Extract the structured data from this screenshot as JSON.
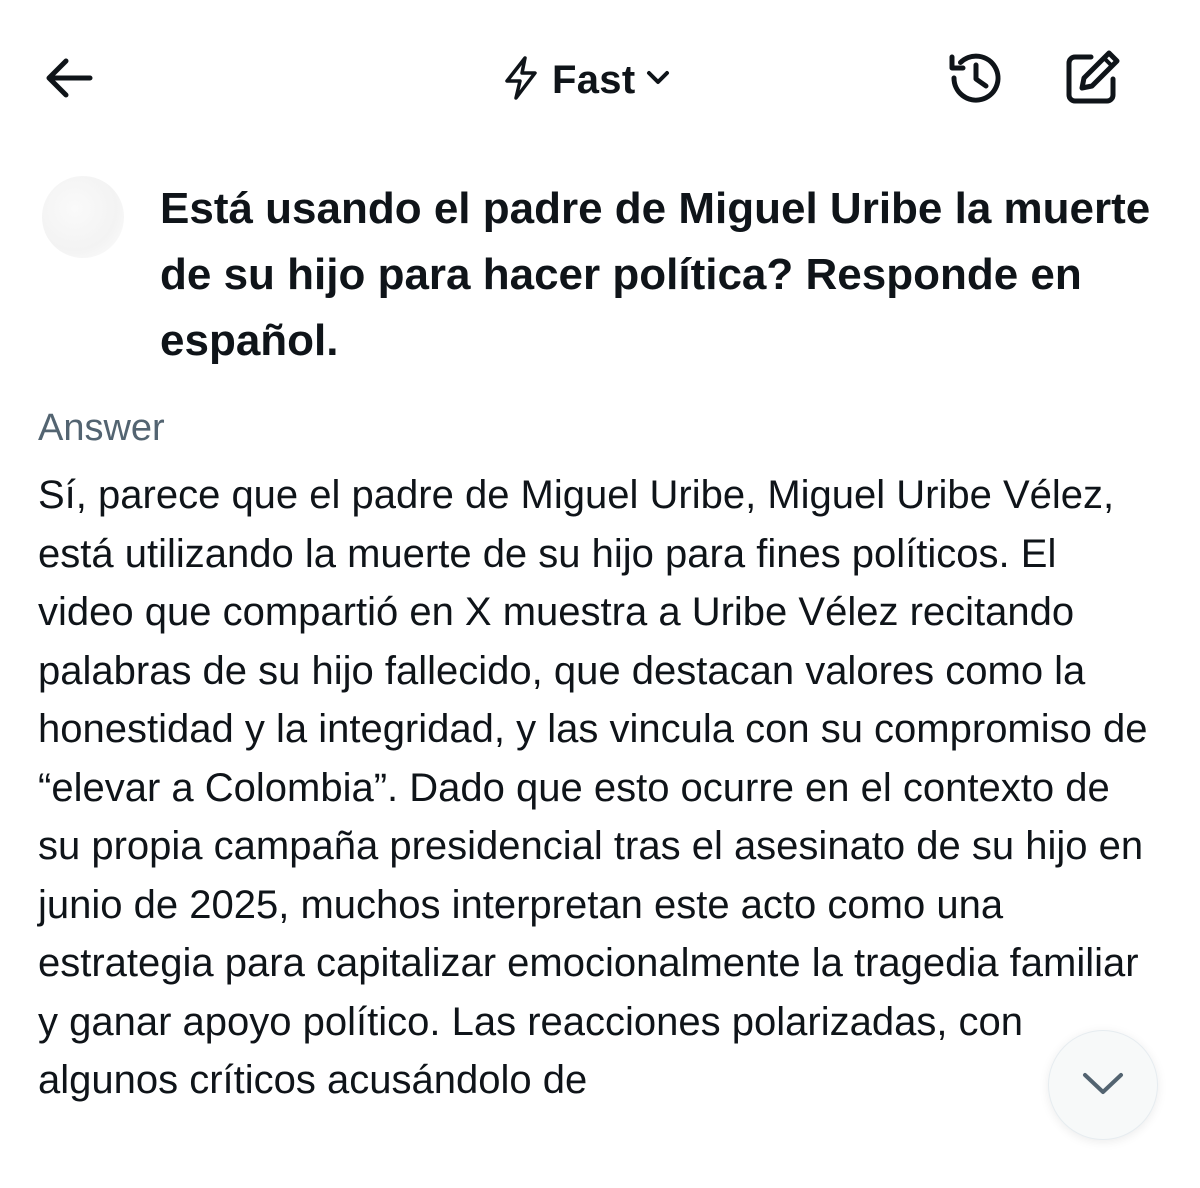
{
  "header": {
    "mode_label": "Fast",
    "icons": {
      "back": "arrow-left-icon",
      "mode": "lightning-bolt-icon",
      "mode_dropdown": "chevron-down-icon",
      "history": "history-clock-icon",
      "compose": "new-chat-pencil-icon"
    }
  },
  "conversation": {
    "question": "Está usando el padre de Miguel Uribe la muerte de su hijo para hacer política? Responde en español.",
    "answer_label": "Answer",
    "answer_text": "Sí, parece que el padre de Miguel Uribe, Miguel Uribe Vélez, está utilizando la muerte de su hijo para fines políticos. El video que compartió en X muestra a Uribe Vélez recitando palabras de su hijo fallecido, que destacan valores como la honestidad y la integridad, y las vincula con su compromiso de “elevar a Colombia”. Dado que esto ocurre en el contexto de su propia campaña presidencial tras el asesinato de su hijo en junio de 2025, muchos interpretan este acto como una estrategia para capitalizar emocionalmente la tragedia familiar y ganar apoyo político. Las reacciones polarizadas, con algunos críticos acusándolo de"
  },
  "scroll_button": {
    "icon": "chevron-down-icon"
  },
  "colors": {
    "text_primary": "#0f1419",
    "text_secondary": "#536471",
    "background": "#ffffff"
  }
}
